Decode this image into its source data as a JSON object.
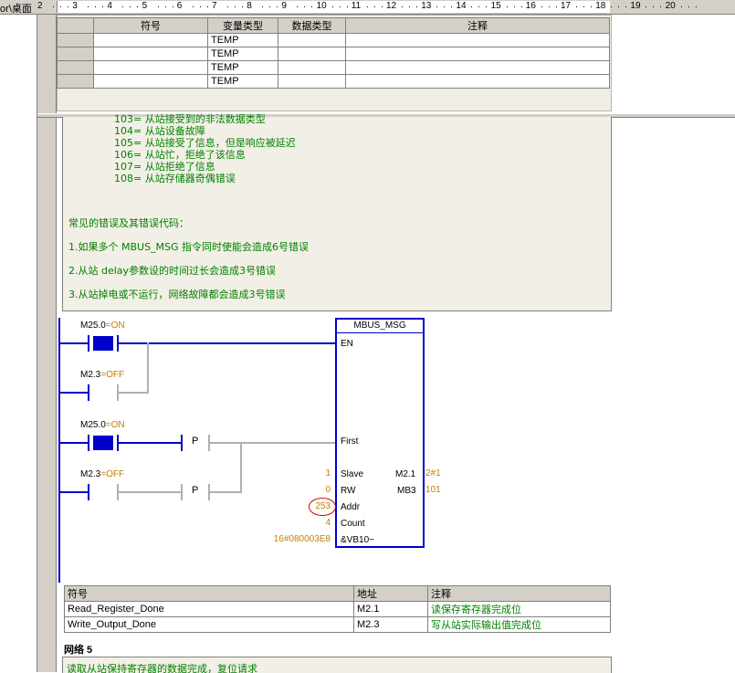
{
  "ruler": {
    "path": "or\\桌面",
    "marks": [
      "2",
      "3",
      "4",
      "5",
      "6",
      "7",
      "8",
      "9",
      "10",
      "11",
      "12",
      "13",
      "14",
      "15",
      "16",
      "17",
      "18",
      "19",
      "20"
    ]
  },
  "var_table": {
    "headers": [
      "符号",
      "变量类型",
      "数据类型",
      "注释"
    ],
    "rows": [
      {
        "var_type": "TEMP"
      },
      {
        "var_type": "TEMP"
      },
      {
        "var_type": "TEMP"
      },
      {
        "var_type": "TEMP"
      }
    ]
  },
  "comment": {
    "lines": [
      {
        "text": "103= 从站接受到的非法数据类型",
        "indent": true,
        "partial": true
      },
      {
        "text": "104= 从站设备故障",
        "indent": true
      },
      {
        "text": "105= 从站接受了信息，但是响应被延迟",
        "indent": true
      },
      {
        "text": "106= 从站忙，拒绝了该信息",
        "indent": true
      },
      {
        "text": "107= 从站拒绝了信息",
        "indent": true
      },
      {
        "text": "108= 从站存储器奇偶错误",
        "indent": true
      },
      {
        "text": "常见的错误及其错误代码：",
        "indent": false
      },
      {
        "text": "1.如果多个 MBUS_MSG 指令同时使能会造成6号错误",
        "indent": false
      },
      {
        "text": "2.从站 delay参数设的时间过长会造成3号错误",
        "indent": false
      },
      {
        "text": "3.从站掉电或不运行，网络故障都会造成3号错误",
        "indent": false
      }
    ]
  },
  "ladder": {
    "contact1": {
      "addr": "M25.0",
      "state": "=ON"
    },
    "contact2": {
      "addr": "M2.3",
      "state": "=OFF"
    },
    "contact3": {
      "addr": "M25.0",
      "state": "=ON"
    },
    "contact4": {
      "addr": "M2.3",
      "state": "=OFF"
    },
    "p_label": "P",
    "block": {
      "title": "MBUS_MSG",
      "pins": {
        "en": "EN",
        "first": "First",
        "slave": "Slave",
        "rw": "RW",
        "addr": "Addr",
        "count": "Count",
        "data": "&VB10~"
      },
      "outputs": {
        "done": "M2.1",
        "error": "MB3"
      },
      "values": {
        "slave": "1",
        "rw": "0",
        "addr": "253",
        "count": "4",
        "data": "16#080003E8",
        "done": "2#1",
        "error": "101"
      }
    }
  },
  "symbol_table": {
    "headers": [
      "符号",
      "地址",
      "注释"
    ],
    "rows": [
      {
        "symbol": "Read_Register_Done",
        "addr": "M2.1",
        "comment": "读保存寄存器完成位"
      },
      {
        "symbol": "Write_Output_Done",
        "addr": "M2.3",
        "comment": "写从站实际输出值完成位"
      }
    ]
  },
  "network5": {
    "title": "网络 5",
    "comment": "读取从站保持寄存器的数据完成，复位请求"
  },
  "colors": {
    "rail": "#0000cc",
    "comment_text": "#008000",
    "value": "#c08000",
    "circle": "#cc0000"
  }
}
